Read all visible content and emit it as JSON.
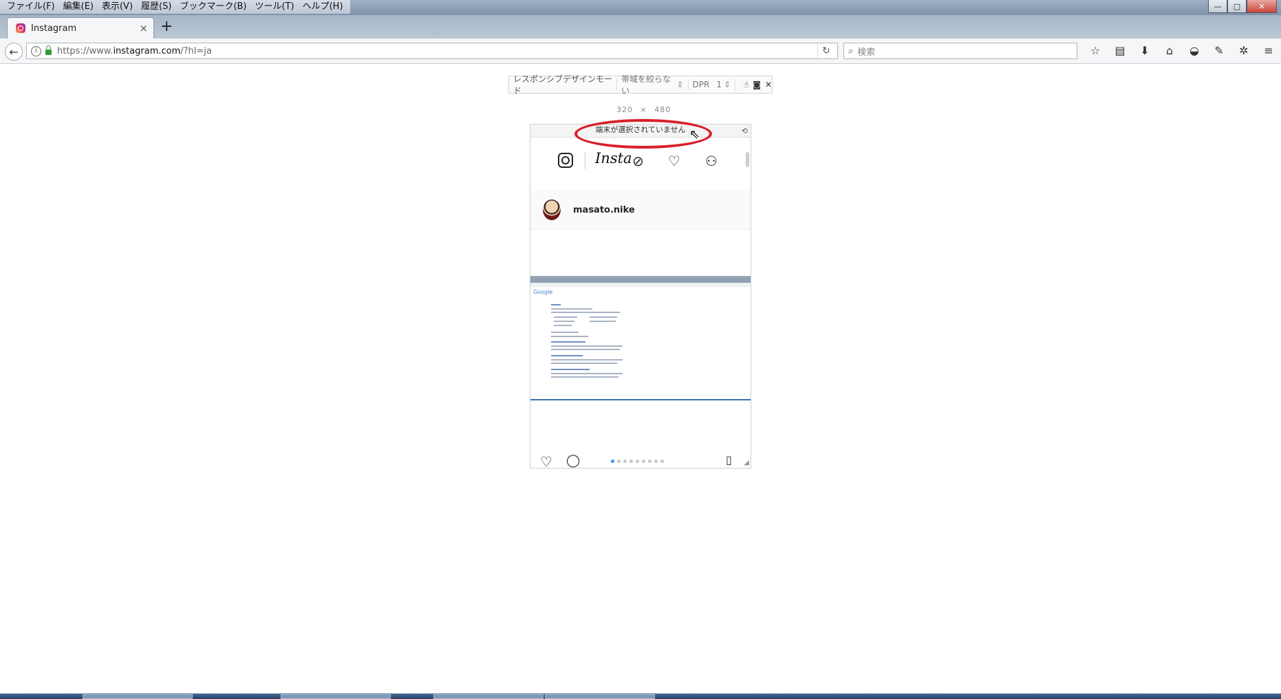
{
  "menu": {
    "items": [
      "ファイル(F)",
      "編集(E)",
      "表示(V)",
      "履歴(S)",
      "ブックマーク(B)",
      "ツール(T)",
      "ヘルプ(H)"
    ]
  },
  "window_controls": {
    "minimize": "—",
    "maximize": "□",
    "close": "✕"
  },
  "tab": {
    "title": "Instagram",
    "close": "×",
    "new_tab": "+"
  },
  "nav": {
    "back": "←",
    "info": "i",
    "url_prefix": "https://www.",
    "url_domain": "instagram.com",
    "url_path": "/?hl=ja",
    "reload": "↻",
    "search_icon": "⌕",
    "search_placeholder": "検索"
  },
  "toolbar_icons": [
    {
      "name": "bookmark-star-icon",
      "glyph": "☆"
    },
    {
      "name": "reading-list-icon",
      "glyph": "▤"
    },
    {
      "name": "download-icon",
      "glyph": "⬇"
    },
    {
      "name": "home-icon",
      "glyph": "⌂"
    },
    {
      "name": "pocket-icon",
      "glyph": "◒"
    },
    {
      "name": "extension-icon",
      "glyph": "✎"
    },
    {
      "name": "addon-icon",
      "glyph": "✲"
    },
    {
      "name": "hamburger-menu-icon",
      "glyph": "≡"
    }
  ],
  "rdm": {
    "mode_label": "レスポンシブデザインモード",
    "throttle": "帯域を絞らない",
    "dpr_label": "DPR",
    "dpr_value": "1",
    "touch_icon": "☝",
    "screenshot_icon": "◙",
    "close_icon": "✕",
    "width": "320",
    "times": "×",
    "height": "480",
    "device_label": "端末が選択されていません",
    "rotate_icon": "⟲"
  },
  "instagram": {
    "wordmark": "Insta",
    "explore_icon": "⊘",
    "heart_icon": "♡",
    "profile_icon": "⚇",
    "username": "masato.nike",
    "img_logo": "Google",
    "like_icon": "♡",
    "comment_icon": "◯",
    "save_icon": "▯",
    "resize_icon": "◢",
    "carousel_count": 9,
    "carousel_active": 1
  },
  "colors": {
    "highlight": "#d8202a",
    "carousel_active": "#3897f0"
  }
}
